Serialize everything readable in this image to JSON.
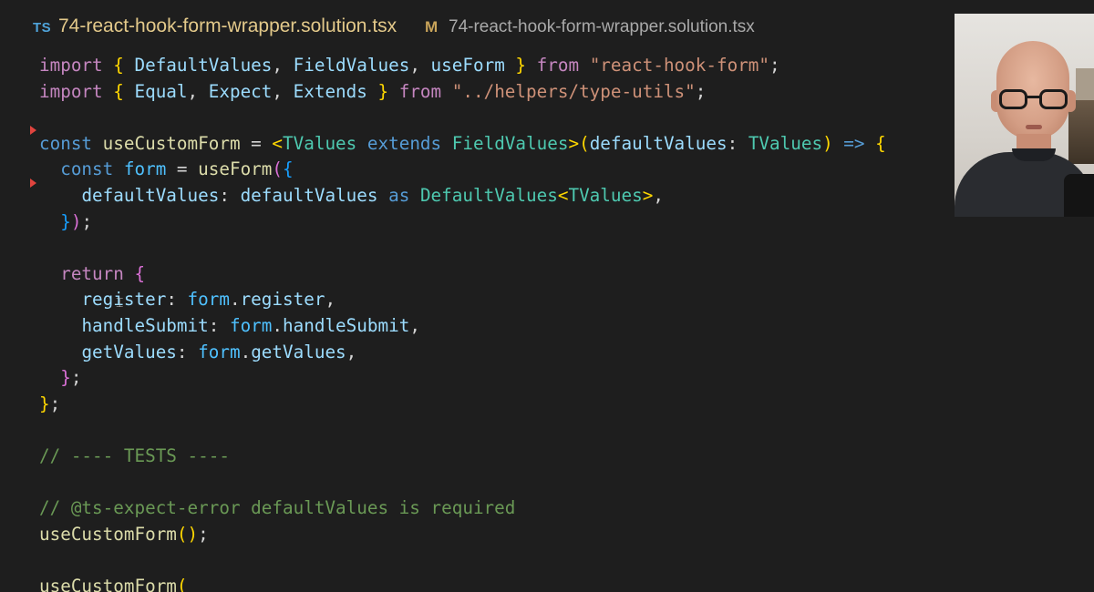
{
  "tab": {
    "language_badge": "TS",
    "filename": "74-react-hook-form-wrapper.solution.tsx",
    "modified_marker": "M",
    "breadcrumb": "74-react-hook-form-wrapper.solution.tsx"
  },
  "editor": {
    "lines": [
      [
        {
          "t": "import",
          "c": "kw2"
        },
        {
          "t": " ",
          "c": "punc"
        },
        {
          "t": "{",
          "c": "brace"
        },
        {
          "t": " DefaultValues",
          "c": "ident"
        },
        {
          "t": ", ",
          "c": "punc"
        },
        {
          "t": "FieldValues",
          "c": "ident"
        },
        {
          "t": ", ",
          "c": "punc"
        },
        {
          "t": "useForm",
          "c": "ident"
        },
        {
          "t": " ",
          "c": "punc"
        },
        {
          "t": "}",
          "c": "brace"
        },
        {
          "t": " from",
          "c": "kw2"
        },
        {
          "t": " ",
          "c": "punc"
        },
        {
          "t": "\"react-hook-form\"",
          "c": "str"
        },
        {
          "t": ";",
          "c": "punc"
        }
      ],
      [
        {
          "t": "import",
          "c": "kw2"
        },
        {
          "t": " ",
          "c": "punc"
        },
        {
          "t": "{",
          "c": "brace"
        },
        {
          "t": " Equal",
          "c": "ident"
        },
        {
          "t": ", ",
          "c": "punc"
        },
        {
          "t": "Expect",
          "c": "ident"
        },
        {
          "t": ", ",
          "c": "punc"
        },
        {
          "t": "Extends",
          "c": "ident"
        },
        {
          "t": " ",
          "c": "punc"
        },
        {
          "t": "}",
          "c": "brace"
        },
        {
          "t": " from",
          "c": "kw2"
        },
        {
          "t": " ",
          "c": "punc"
        },
        {
          "t": "\"../helpers/type-utils\"",
          "c": "str"
        },
        {
          "t": ";",
          "c": "punc"
        }
      ],
      [],
      [
        {
          "t": "const",
          "c": "kw"
        },
        {
          "t": " ",
          "c": "punc"
        },
        {
          "t": "useCustomForm",
          "c": "fn"
        },
        {
          "t": " = ",
          "c": "punc"
        },
        {
          "t": "<",
          "c": "brace"
        },
        {
          "t": "TValues",
          "c": "type"
        },
        {
          "t": " extends ",
          "c": "kw"
        },
        {
          "t": "FieldValues",
          "c": "type"
        },
        {
          "t": ">",
          "c": "brace"
        },
        {
          "t": "(",
          "c": "brace"
        },
        {
          "t": "defaultValues",
          "c": "ident"
        },
        {
          "t": ": ",
          "c": "punc"
        },
        {
          "t": "TValues",
          "c": "type"
        },
        {
          "t": ")",
          "c": "brace"
        },
        {
          "t": " => ",
          "c": "kw"
        },
        {
          "t": "{",
          "c": "brace"
        }
      ],
      [
        {
          "t": "  ",
          "c": "punc"
        },
        {
          "t": "const",
          "c": "kw"
        },
        {
          "t": " ",
          "c": "punc"
        },
        {
          "t": "form",
          "c": "var"
        },
        {
          "t": " = ",
          "c": "punc"
        },
        {
          "t": "useForm",
          "c": "fn"
        },
        {
          "t": "(",
          "c": "brace2"
        },
        {
          "t": "{",
          "c": "brace3"
        }
      ],
      [
        {
          "t": "    ",
          "c": "punc"
        },
        {
          "t": "defaultValues",
          "c": "ident"
        },
        {
          "t": ": ",
          "c": "punc"
        },
        {
          "t": "defaultValues",
          "c": "ident"
        },
        {
          "t": " as ",
          "c": "kw"
        },
        {
          "t": "DefaultValues",
          "c": "type"
        },
        {
          "t": "<",
          "c": "brace"
        },
        {
          "t": "TValues",
          "c": "type"
        },
        {
          "t": ">",
          "c": "brace"
        },
        {
          "t": ",",
          "c": "punc"
        }
      ],
      [
        {
          "t": "  ",
          "c": "punc"
        },
        {
          "t": "}",
          "c": "brace3"
        },
        {
          "t": ")",
          "c": "brace2"
        },
        {
          "t": ";",
          "c": "punc"
        }
      ],
      [],
      [
        {
          "t": "  ",
          "c": "punc"
        },
        {
          "t": "return",
          "c": "kw2"
        },
        {
          "t": " ",
          "c": "punc"
        },
        {
          "t": "{",
          "c": "brace2"
        }
      ],
      [
        {
          "t": "    ",
          "c": "punc"
        },
        {
          "t": "register",
          "c": "ident"
        },
        {
          "t": ": ",
          "c": "punc"
        },
        {
          "t": "form",
          "c": "var"
        },
        {
          "t": ".",
          "c": "punc"
        },
        {
          "t": "register",
          "c": "ident"
        },
        {
          "t": ",",
          "c": "punc"
        }
      ],
      [
        {
          "t": "    ",
          "c": "punc"
        },
        {
          "t": "handleSubmit",
          "c": "ident"
        },
        {
          "t": ": ",
          "c": "punc"
        },
        {
          "t": "form",
          "c": "var"
        },
        {
          "t": ".",
          "c": "punc"
        },
        {
          "t": "handleSubmit",
          "c": "ident"
        },
        {
          "t": ",",
          "c": "punc"
        }
      ],
      [
        {
          "t": "    ",
          "c": "punc"
        },
        {
          "t": "getValues",
          "c": "ident"
        },
        {
          "t": ": ",
          "c": "punc"
        },
        {
          "t": "form",
          "c": "var"
        },
        {
          "t": ".",
          "c": "punc"
        },
        {
          "t": "getValues",
          "c": "ident"
        },
        {
          "t": ",",
          "c": "punc"
        }
      ],
      [
        {
          "t": "  ",
          "c": "punc"
        },
        {
          "t": "}",
          "c": "brace2"
        },
        {
          "t": ";",
          "c": "punc"
        }
      ],
      [
        {
          "t": "}",
          "c": "brace"
        },
        {
          "t": ";",
          "c": "punc"
        }
      ],
      [],
      [
        {
          "t": "// ---- TESTS ----",
          "c": "comment"
        }
      ],
      [],
      [
        {
          "t": "// @ts-expect-error defaultValues is required",
          "c": "comment"
        }
      ],
      [
        {
          "t": "useCustomForm",
          "c": "fn"
        },
        {
          "t": "()",
          "c": "brace"
        },
        {
          "t": ";",
          "c": "punc"
        }
      ],
      [],
      [
        {
          "t": "useCustomForm",
          "c": "fn"
        },
        {
          "t": "(",
          "c": "brace"
        }
      ]
    ]
  },
  "webcam": {
    "icon": "presenter-video"
  }
}
